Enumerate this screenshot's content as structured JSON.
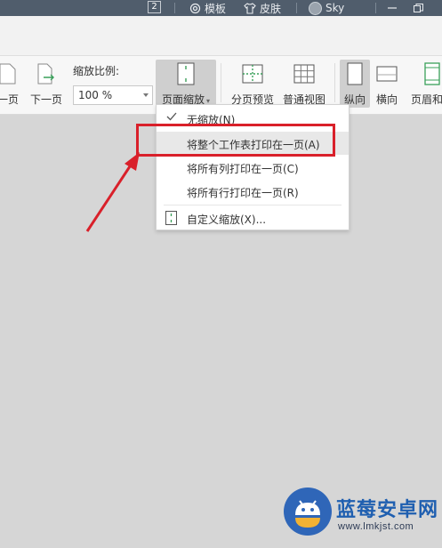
{
  "titlebar": {
    "badge": "2",
    "template_label": "模板",
    "skin_label": "皮肤",
    "user_name": "Sky"
  },
  "ribbon": {
    "prev_page_label": "一页",
    "next_page_label": "下一页",
    "zoom_ratio_label": "缩放比例:",
    "zoom_value": "100 %",
    "page_scale_label": "页面缩放",
    "page_break_preview_label": "分页预览",
    "normal_view_label": "普通视图",
    "portrait_label": "纵向",
    "landscape_label": "横向",
    "header_footer_label": "页眉和页"
  },
  "menu": {
    "items": [
      {
        "label": "无缩放(N)",
        "checked": true
      },
      {
        "label": "将整个工作表打印在一页(A)",
        "highlighted": true
      },
      {
        "label": "将所有列打印在一页(C)"
      },
      {
        "label": "将所有行打印在一页(R)"
      },
      {
        "label": "自定义缩放(X)..."
      }
    ]
  },
  "watermark": {
    "title": "蓝莓安卓网",
    "url": "www.lmkjst.com"
  },
  "colors": {
    "titlebar": "#505d6c",
    "highlight": "#d9202a",
    "canvas": "#d6d6d6",
    "accent_green": "#3aa05a"
  }
}
